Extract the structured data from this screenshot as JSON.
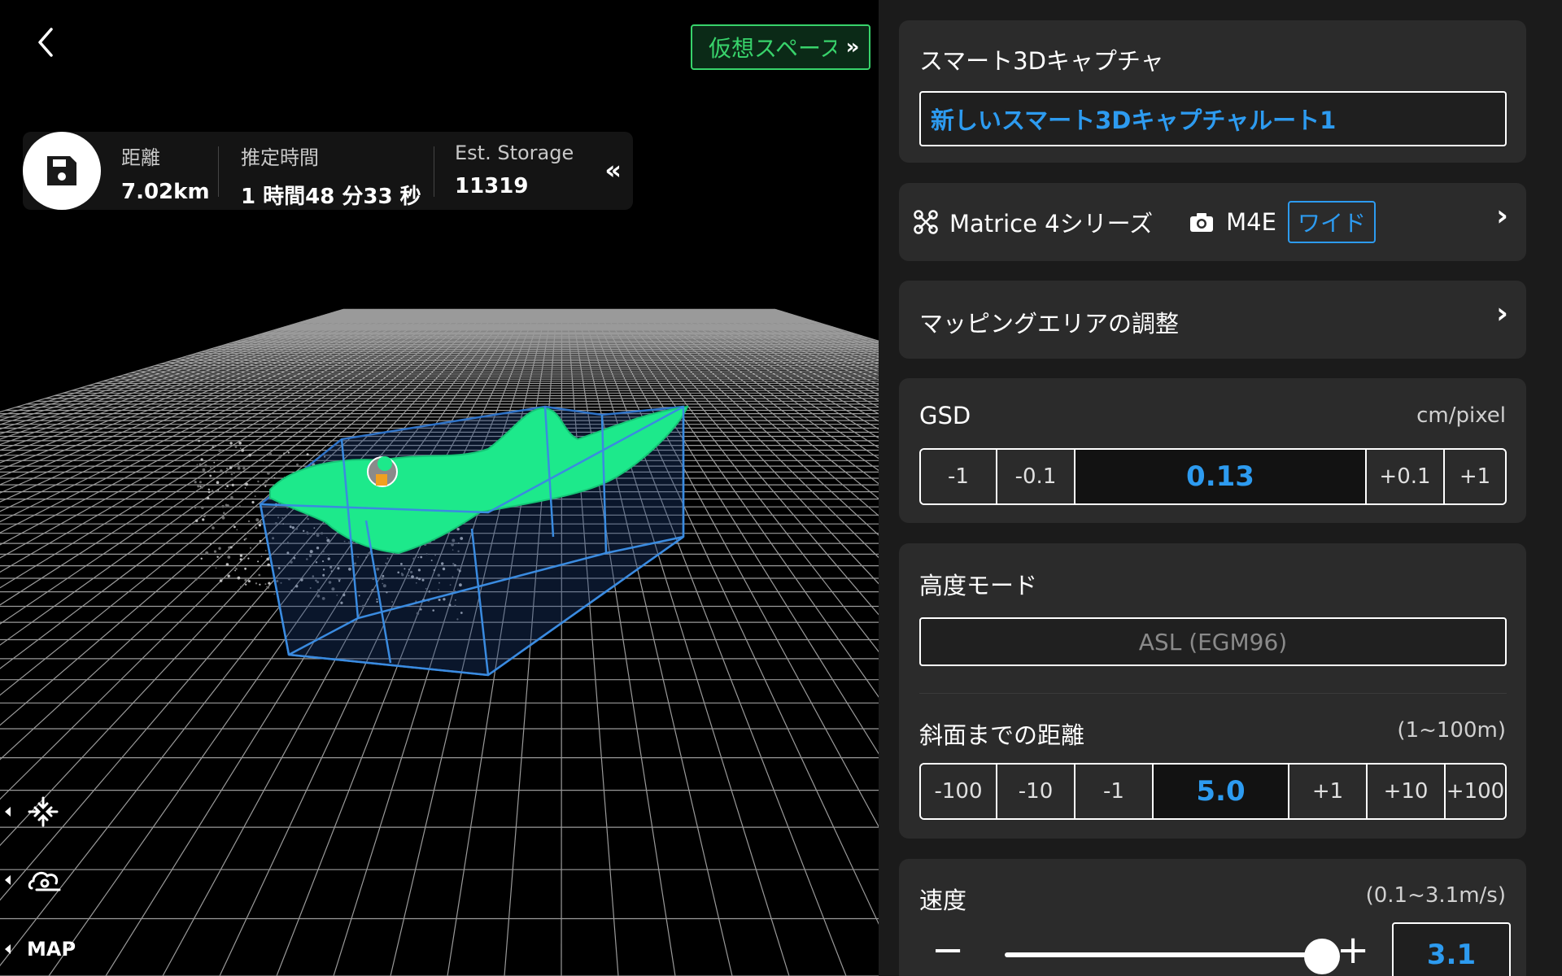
{
  "header": {
    "virtual_space_label": "仮想スペース",
    "expand_glyph": "»"
  },
  "stats": {
    "distance": {
      "label": "距離",
      "value": "7.02km"
    },
    "time": {
      "label": "推定時間",
      "value": "1 時間48 分33 秒"
    },
    "storage": {
      "label": "Est. Storage",
      "value": "11319"
    },
    "collapse_glyph": "«"
  },
  "tools": {
    "map_label": "MAP"
  },
  "panel": {
    "capture": {
      "title": "スマート3Dキャプチャ",
      "route_name": "新しいスマート3Dキャプチャルート1"
    },
    "device": {
      "drone": "Matrice 4シリーズ",
      "camera": "M4E",
      "lens": "ワイド",
      "chevron": "›"
    },
    "mapping": {
      "label": "マッピングエリアの調整",
      "chevron": "›"
    },
    "gsd": {
      "label": "GSD",
      "unit": "cm/pixel",
      "value": "0.13",
      "minus": [
        "-1",
        "-0.1"
      ],
      "plus": [
        "+0.1",
        "+1"
      ]
    },
    "altitude": {
      "label": "高度モード",
      "value": "ASL (EGM96)"
    },
    "slope": {
      "label": "斜面までの距離",
      "range": "(1~100m)",
      "value": "5.0",
      "minus": [
        "-100",
        "-10",
        "-1"
      ],
      "plus": [
        "+1",
        "+10",
        "+100"
      ]
    },
    "speed": {
      "label": "速度",
      "range": "(0.1~3.1m/s)",
      "value": "3.1",
      "slider_fraction": 1.0,
      "minus_glyph": "−",
      "plus_glyph": "+"
    }
  },
  "colors": {
    "accent_blue": "#2d9bf0",
    "virtual_green": "#38d36b",
    "terrain_green": "#1de98b",
    "box_blue": "#2f73c8"
  },
  "icons": [
    "back-icon",
    "save-icon",
    "drone-icon",
    "camera-icon",
    "recenter-icon",
    "location-cloud-icon"
  ]
}
